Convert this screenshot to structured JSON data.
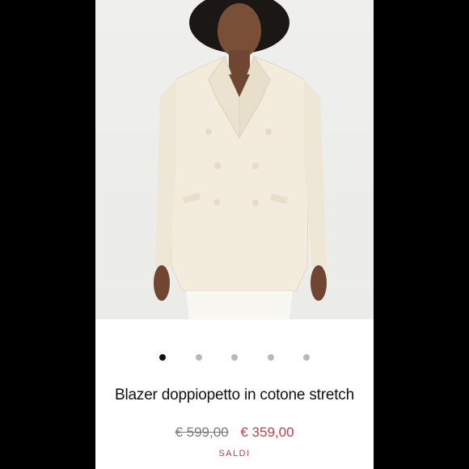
{
  "product": {
    "title": "Blazer doppiopetto in cotone stretch",
    "old_price": "€ 599,00",
    "price": "€ 359,00",
    "badge": "SALDI",
    "image_icon": "product-photo-blazer"
  },
  "carousel": {
    "total": 5,
    "active_index": 0
  },
  "colors": {
    "sale": "#c0404a",
    "dot_active": "#111111",
    "dot_inactive": "#b8b8b8"
  }
}
